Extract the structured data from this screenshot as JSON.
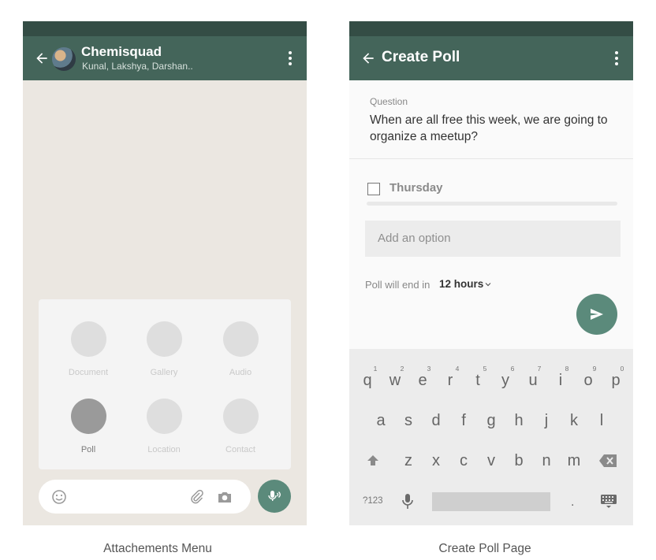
{
  "left": {
    "header": {
      "title": "Chemisquad",
      "subtitle": "Kunal, Lakshya, Darshan.."
    },
    "attach_menu": {
      "items": [
        {
          "label": "Document",
          "active": false
        },
        {
          "label": "Gallery",
          "active": false
        },
        {
          "label": "Audio",
          "active": false
        },
        {
          "label": "Poll",
          "active": true
        },
        {
          "label": "Location",
          "active": false
        },
        {
          "label": "Contact",
          "active": false
        }
      ]
    },
    "icons": [
      "back-arrow-icon",
      "more-vert-icon",
      "emoji-icon",
      "attach-icon",
      "camera-icon",
      "mic-icon"
    ],
    "caption": "Attachements Menu"
  },
  "right": {
    "header": {
      "title": "Create Poll"
    },
    "question_label": "Question",
    "question_text": "When are all free this week, we are going to organize a meetup?",
    "option_1": "Thursday",
    "add_option_placeholder": "Add an option",
    "poll_end_label": "Poll will end in",
    "poll_duration": "12 hours",
    "keyboard": {
      "row1": [
        "q",
        "w",
        "e",
        "r",
        "t",
        "y",
        "u",
        "i",
        "o",
        "p"
      ],
      "row1_numbers": [
        "1",
        "2",
        "3",
        "4",
        "5",
        "6",
        "7",
        "8",
        "9",
        "0"
      ],
      "row2": [
        "a",
        "s",
        "d",
        "f",
        "g",
        "h",
        "j",
        "k",
        "l"
      ],
      "row3": [
        "z",
        "x",
        "c",
        "v",
        "b",
        "n",
        "m"
      ],
      "symbols_key": "?123",
      "period_key": "."
    },
    "icons": [
      "back-arrow-icon",
      "more-vert-icon",
      "send-icon",
      "shift-icon",
      "backspace-icon",
      "mic-icon",
      "keyboard-hide-icon"
    ],
    "caption": "Create Poll Page"
  },
  "colors": {
    "header": "#44655a",
    "status_bar": "#344d45",
    "fab": "#5b8a7b",
    "chat_bg": "#ebe7e1"
  }
}
